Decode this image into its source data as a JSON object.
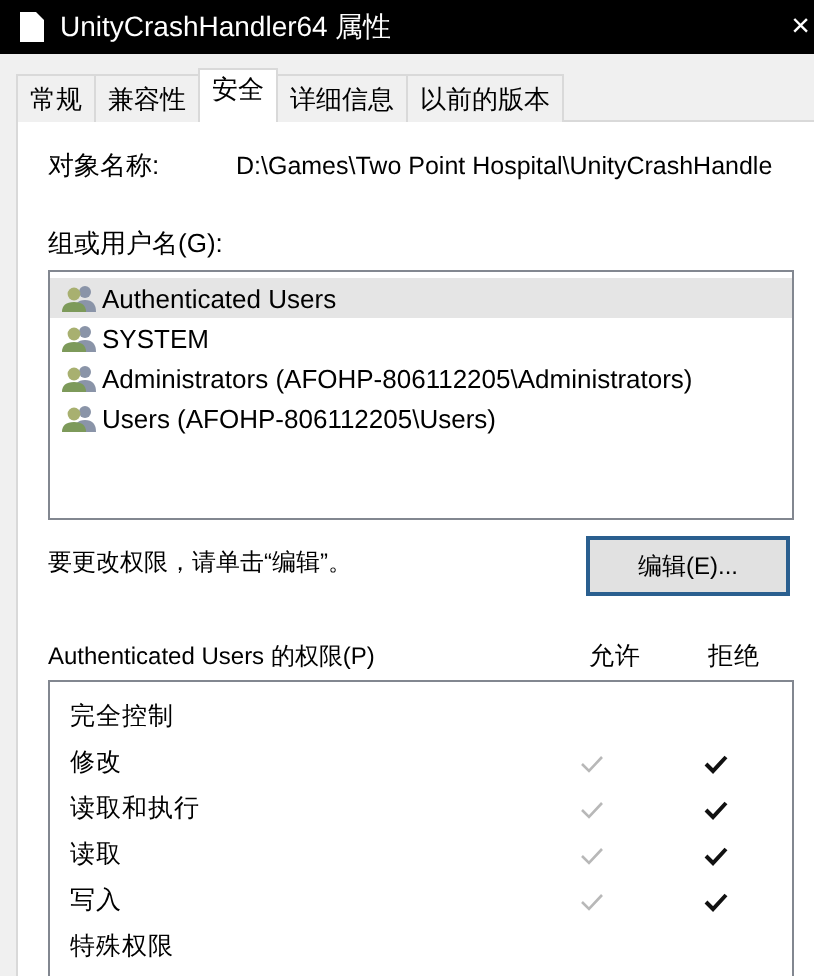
{
  "window": {
    "title": "UnityCrashHandler64 属性",
    "close": "×"
  },
  "tabs": [
    {
      "label": "常规",
      "selected": false
    },
    {
      "label": "兼容性",
      "selected": false
    },
    {
      "label": "安全",
      "selected": true
    },
    {
      "label": "详细信息",
      "selected": false
    },
    {
      "label": "以前的版本",
      "selected": false
    }
  ],
  "object_name": {
    "label": "对象名称:",
    "value": "D:\\Games\\Two Point Hospital\\UnityCrashHandle"
  },
  "groups": {
    "label": "组或用户名(G):",
    "items": [
      {
        "name": "Authenticated Users",
        "selected": true
      },
      {
        "name": "SYSTEM",
        "selected": false
      },
      {
        "name": "Administrators (AFOHP-806112205\\Administrators)",
        "selected": false
      },
      {
        "name": "Users (AFOHP-806112205\\Users)",
        "selected": false
      }
    ]
  },
  "edit_hint": "要更改权限，请单击“编辑”。",
  "edit_button": "编辑(E)...",
  "permissions": {
    "label": "Authenticated Users 的权限(P)",
    "allow_heading": "允许",
    "deny_heading": "拒绝",
    "allow_disabled": true,
    "rows": [
      {
        "name": "完全控制",
        "allow": false,
        "deny": false
      },
      {
        "name": "修改",
        "allow": true,
        "deny": true
      },
      {
        "name": "读取和执行",
        "allow": true,
        "deny": true
      },
      {
        "name": "读取",
        "allow": true,
        "deny": true
      },
      {
        "name": "写入",
        "allow": true,
        "deny": true
      },
      {
        "name": "特殊权限",
        "allow": false,
        "deny": false
      }
    ]
  }
}
